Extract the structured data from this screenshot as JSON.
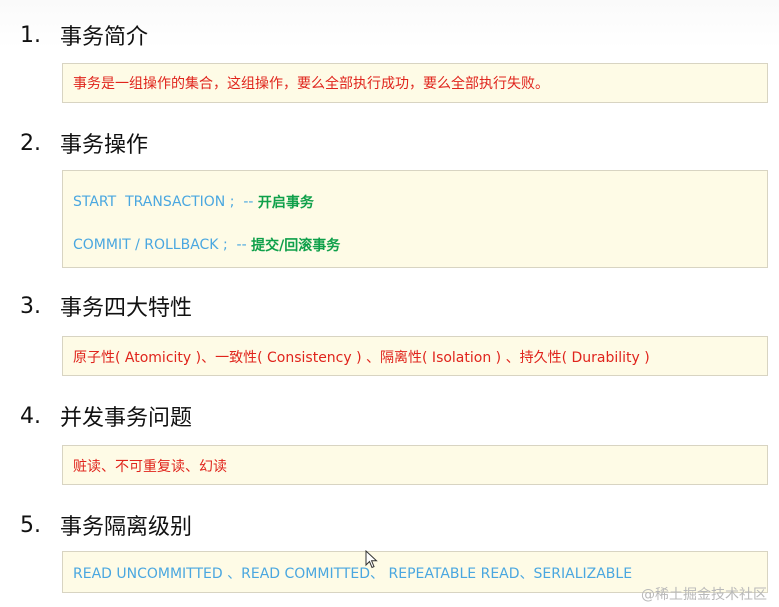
{
  "sections": [
    {
      "number": "1.",
      "title": "事务简介"
    },
    {
      "number": "2.",
      "title": "事务操作"
    },
    {
      "number": "3.",
      "title": "事务四大特性"
    },
    {
      "number": "4.",
      "title": "并发事务问题"
    },
    {
      "number": "5.",
      "title": "事务隔离级别"
    }
  ],
  "intro": {
    "text": "事务是一组操作的集合，这组操作，要么全部执行成功，要么全部执行失败。"
  },
  "operations": {
    "line1_code": "START  TRANSACTION ;  -- ",
    "line1_comment": "开启事务",
    "line2_code": "COMMIT / ROLLBACK ;  -- ",
    "line2_comment": "提交/回滚事务"
  },
  "acid": {
    "text": "原子性( Atomicity )、一致性( Consistency ) 、隔离性( Isolation ) 、持久性( Durability )"
  },
  "problems": {
    "text": "赃读、不可重复读、幻读"
  },
  "isolation": {
    "text": "READ UNCOMMITTED 、READ COMMITTED、 REPEATABLE READ、SERIALIZABLE"
  },
  "watermark": "@稀土掘金技术社区",
  "colors": {
    "red_text": "#e0241c",
    "blue_text": "#4aa7e0",
    "green_text": "#0fa04a",
    "box_background": "#fefbe6"
  }
}
